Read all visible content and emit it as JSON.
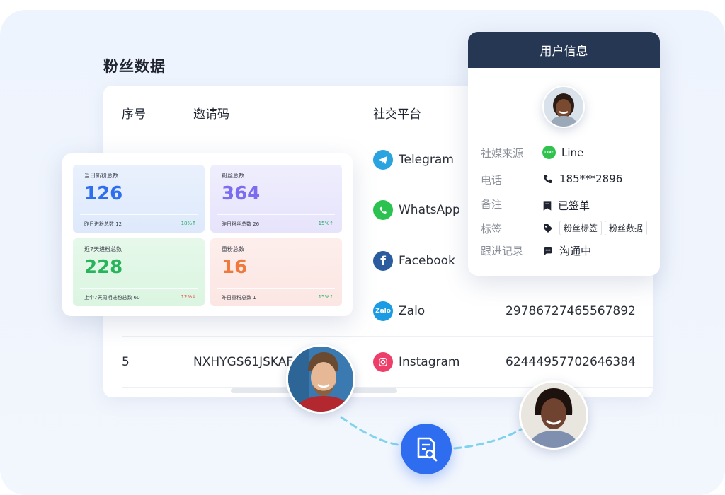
{
  "section_title": "粉丝数据",
  "table": {
    "headers": [
      "序号",
      "邀请码",
      "社交平台"
    ],
    "rows": [
      {
        "index": "",
        "code": "",
        "platform": "Telegram",
        "account": ""
      },
      {
        "index": "",
        "code": "",
        "platform": "WhatsApp",
        "account": ""
      },
      {
        "index": "",
        "code": "",
        "platform": "Facebook",
        "account": ""
      },
      {
        "index": "",
        "code": "",
        "platform": "Zalo",
        "account": "29786727465567892"
      },
      {
        "index": "5",
        "code": "NXHYGS61JSKAF",
        "platform": "Instagram",
        "account": "62444957702646384"
      }
    ]
  },
  "stats": [
    {
      "label": "当日新粉总数",
      "value": "126",
      "foot": "昨日进粉总数 12",
      "pct": "18%↑",
      "color": "#2e6ff0"
    },
    {
      "label": "粉丝总数",
      "value": "364",
      "foot": "昨日粉丝总数 26",
      "pct": "15%↑",
      "color": "#7b6cf0"
    },
    {
      "label": "近7天进粉总数",
      "value": "228",
      "foot": "上个7天周期进粉总数 60",
      "pct": "12%↓",
      "color": "#27b45a"
    },
    {
      "label": "重粉总数",
      "value": "16",
      "foot": "昨日重粉总数 1",
      "pct": "15%↑",
      "color": "#f07a3e"
    }
  ],
  "user": {
    "title": "用户信息",
    "fields": [
      {
        "label": "社媒来源",
        "value": "Line",
        "icon": "line-icon"
      },
      {
        "label": "电话",
        "value": "185***2896",
        "icon": "phone-icon"
      },
      {
        "label": "备注",
        "value": "已签单",
        "icon": "note-icon"
      },
      {
        "label": "标签",
        "tags": [
          "粉丝标签",
          "粉丝数据"
        ],
        "icon": "tag-icon"
      },
      {
        "label": "跟进记录",
        "value": "沟通中",
        "icon": "chat-icon"
      }
    ]
  },
  "line_badge": "LINE",
  "zalo_badge": "Zalo",
  "colors": {
    "header": "#263754",
    "accent": "#2e6cf0",
    "up": "#1fae66",
    "down": "#e8453c"
  }
}
